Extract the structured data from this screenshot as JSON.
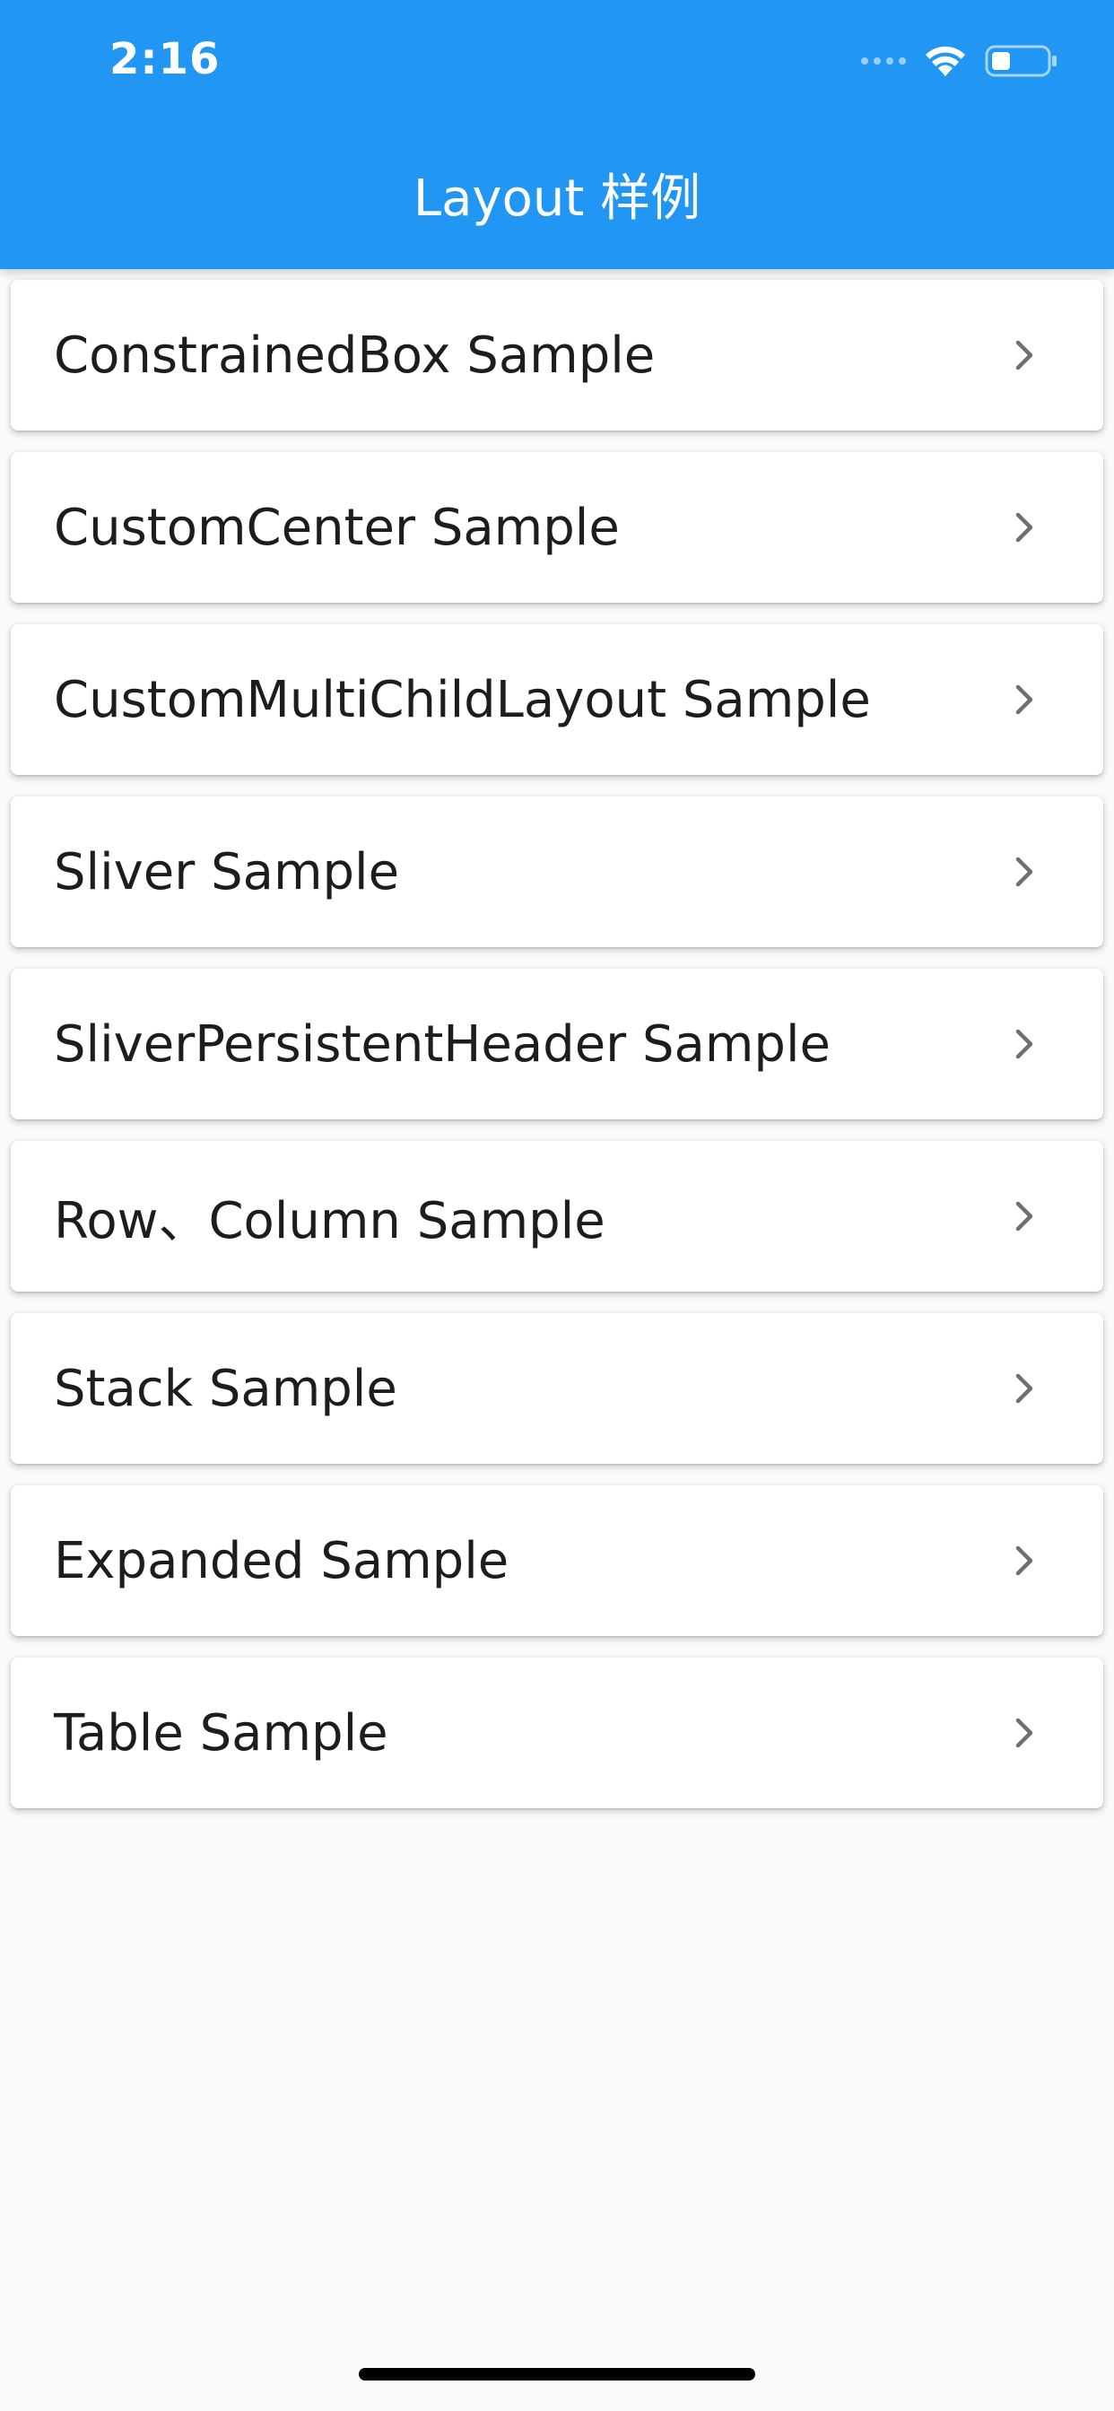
{
  "status_bar": {
    "time": "2:16"
  },
  "app_bar": {
    "title": "Layout 样例",
    "color": "#2196f3"
  },
  "list": {
    "items": [
      {
        "label": "ConstrainedBox Sample",
        "icon": "chevron-right-icon"
      },
      {
        "label": "CustomCenter Sample",
        "icon": "chevron-right-icon"
      },
      {
        "label": "CustomMultiChildLayout Sample",
        "icon": "chevron-right-icon"
      },
      {
        "label": "Sliver Sample",
        "icon": "chevron-right-icon"
      },
      {
        "label": "SliverPersistentHeader Sample",
        "icon": "chevron-right-icon"
      },
      {
        "label": "Row、Column Sample",
        "icon": "chevron-right-icon"
      },
      {
        "label": "Stack Sample",
        "icon": "chevron-right-icon"
      },
      {
        "label": "Expanded Sample",
        "icon": "chevron-right-icon"
      },
      {
        "label": "Table Sample",
        "icon": "chevron-right-icon"
      }
    ]
  }
}
